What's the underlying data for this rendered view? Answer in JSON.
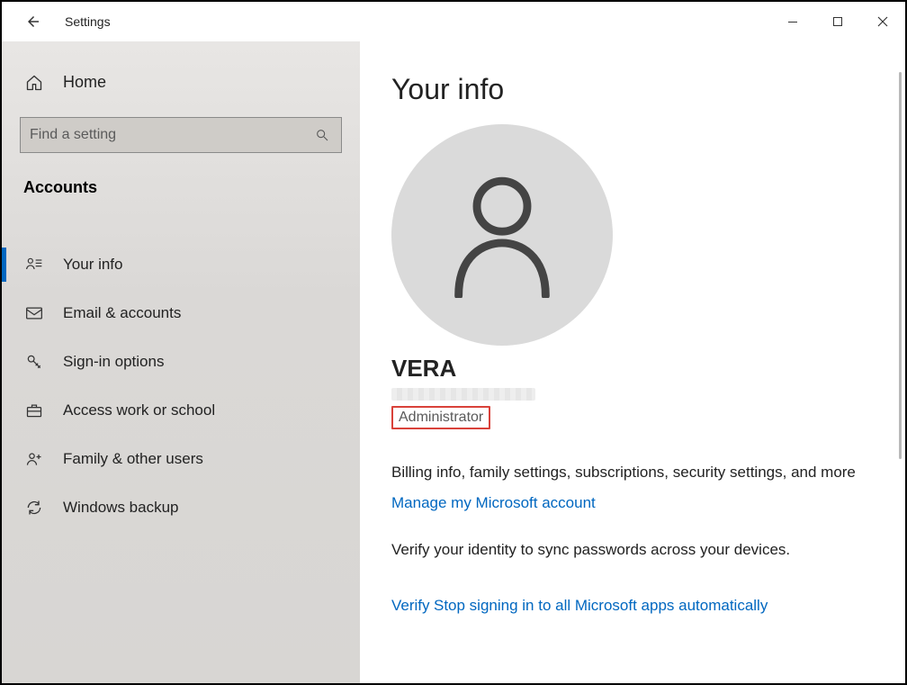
{
  "window": {
    "title": "Settings"
  },
  "sidebar": {
    "home": "Home",
    "search_placeholder": "Find a setting",
    "section": "Accounts",
    "items": [
      {
        "label": "Your info"
      },
      {
        "label": "Email & accounts"
      },
      {
        "label": "Sign-in options"
      },
      {
        "label": "Access work or school"
      },
      {
        "label": "Family & other users"
      },
      {
        "label": "Windows backup"
      }
    ]
  },
  "main": {
    "heading": "Your info",
    "username": "VERA",
    "role": "Administrator",
    "billing_desc": "Billing info, family settings, subscriptions, security settings, and more",
    "manage_link": "Manage my Microsoft account",
    "verify_desc": "Verify your identity to sync passwords across your devices.",
    "verify_link": "Verify",
    "stop_signin_link": "Stop signing in to all Microsoft apps automatically"
  }
}
